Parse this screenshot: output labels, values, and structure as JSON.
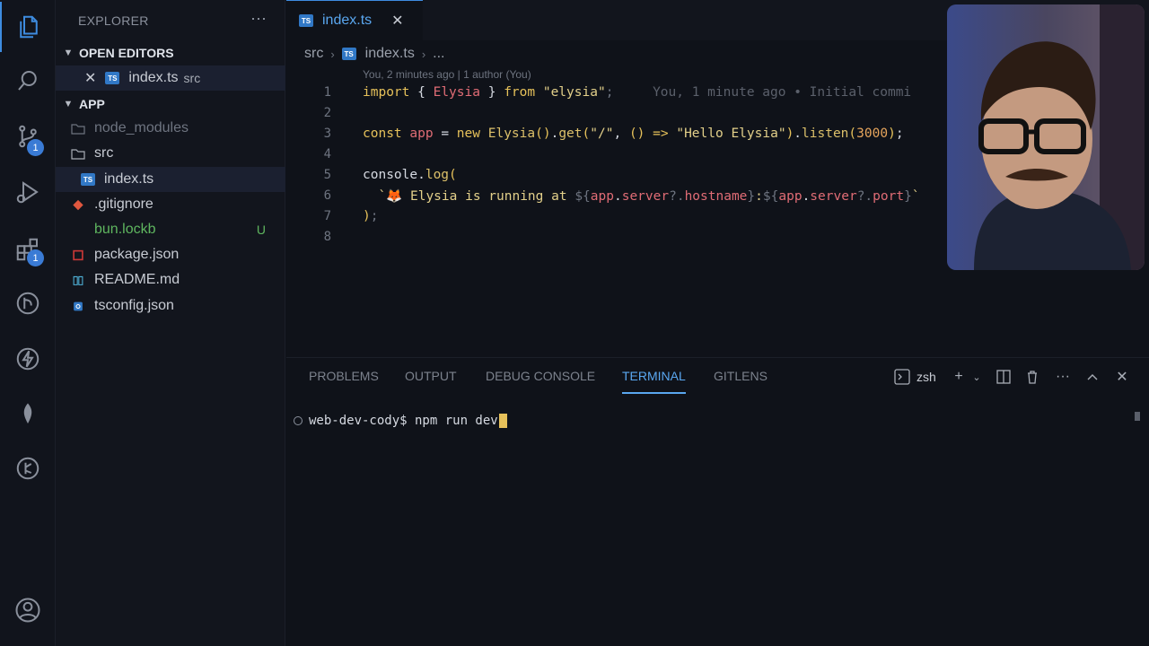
{
  "activity": {
    "source_control_badge": "1",
    "extensions_badge": "1"
  },
  "sidebar": {
    "title": "EXPLORER",
    "more": "···",
    "open_editors_label": "OPEN EDITORS",
    "open_editor": {
      "name": "index.ts",
      "desc": "src"
    },
    "app_label": "APP",
    "files": [
      {
        "name": "node_modules"
      },
      {
        "name": "src"
      },
      {
        "name": "index.ts"
      },
      {
        "name": ".gitignore"
      },
      {
        "name": "bun.lockb",
        "status": "U"
      },
      {
        "name": "package.json"
      },
      {
        "name": "README.md"
      },
      {
        "name": "tsconfig.json"
      }
    ]
  },
  "tabs": [
    {
      "label": "index.ts",
      "icon": "TS"
    }
  ],
  "breadcrumb": {
    "folder": "src",
    "file": "index.ts",
    "tail": "..."
  },
  "blame_header": "You, 2 minutes ago | 1 author (You)",
  "editor": {
    "line_numbers": [
      "1",
      "2",
      "3",
      "4",
      "5",
      "6",
      "7",
      "8"
    ],
    "inline_blame": "You, 1 minute ago • Initial commi"
  },
  "panel": {
    "tabs": [
      "PROBLEMS",
      "OUTPUT",
      "DEBUG CONSOLE",
      "TERMINAL",
      "GITLENS"
    ],
    "active_tab": "TERMINAL",
    "shell": "zsh",
    "terminal_prompt": "web-dev-cody$ npm run dev"
  },
  "colors": {
    "accent": "#3e8ce0",
    "ts_icon": "#3178c6",
    "git_untracked": "#5fb65f",
    "cursor": "#e6c15a"
  }
}
